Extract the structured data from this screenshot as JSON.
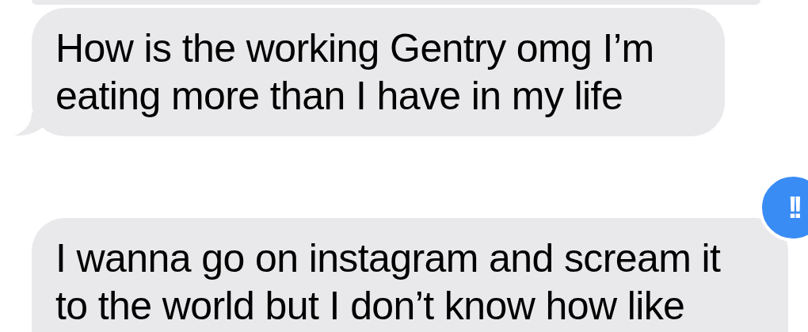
{
  "messages": [
    {
      "partial": true
    },
    {
      "lines": [
        "How is the working Gentry omg I’m",
        "eating more than I have in my life"
      ],
      "tail": true
    },
    {
      "lines": [
        "I wanna go on instagram and scream it",
        "to the world but I don’t know how like"
      ],
      "tapback": "!!"
    }
  ]
}
